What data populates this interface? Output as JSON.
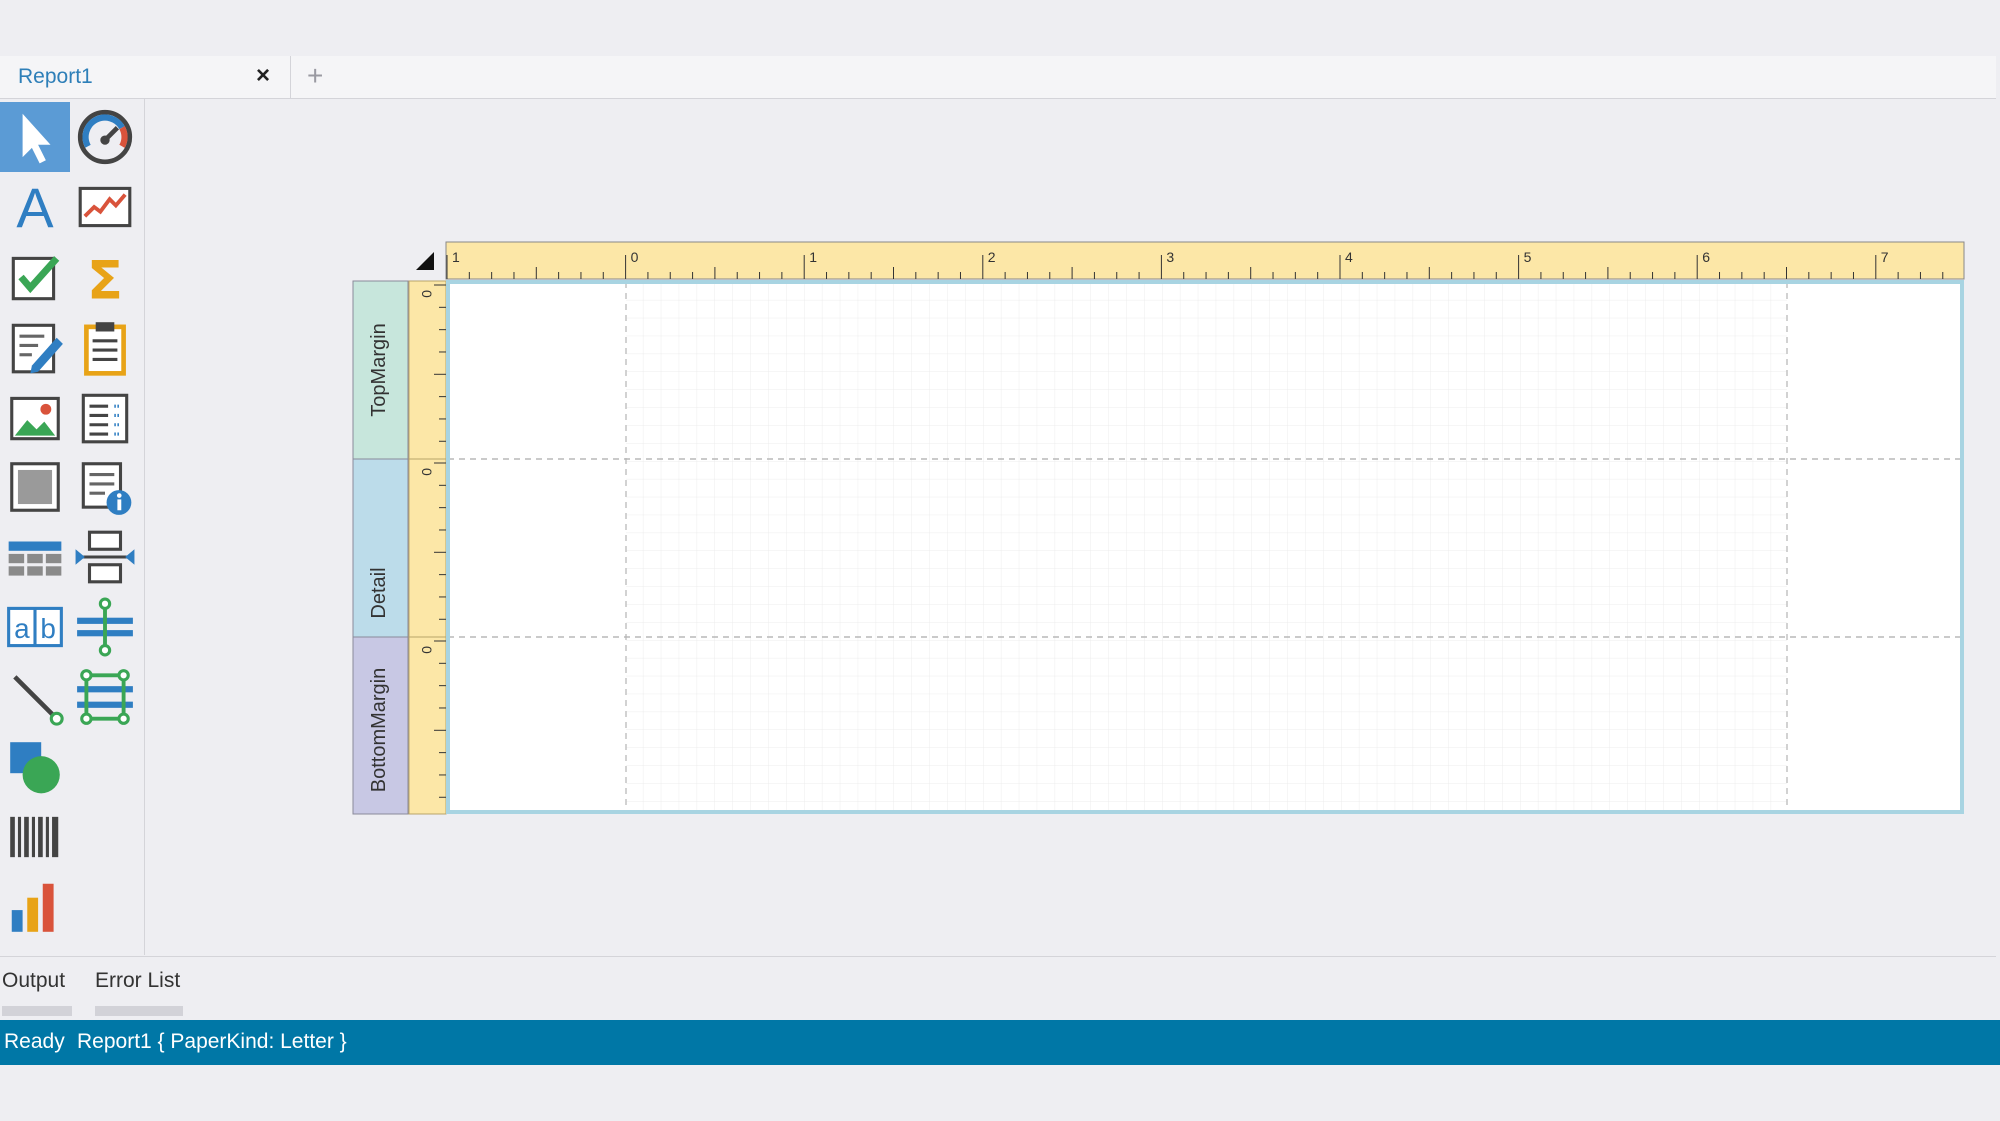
{
  "tabs": {
    "active_label": "Report1",
    "close_glyph": "×",
    "add_glyph": "+"
  },
  "toolbox": {
    "tools": [
      {
        "name": "pointer",
        "icon": "pointer-icon",
        "selected": true
      },
      {
        "name": "gauge",
        "icon": "gauge-icon"
      },
      {
        "name": "label",
        "icon": "label-icon",
        "glyph": "A"
      },
      {
        "name": "sparkline",
        "icon": "sparkline-icon"
      },
      {
        "name": "checkbox",
        "icon": "checkbox-icon"
      },
      {
        "name": "summary",
        "icon": "sigma-icon",
        "glyph": "Σ"
      },
      {
        "name": "richtext",
        "icon": "richtext-icon"
      },
      {
        "name": "subreport",
        "icon": "clipboard-icon"
      },
      {
        "name": "picture",
        "icon": "picture-icon"
      },
      {
        "name": "table-of-contents",
        "icon": "toc-icon"
      },
      {
        "name": "panel",
        "icon": "panel-icon"
      },
      {
        "name": "page-info",
        "icon": "page-info-icon"
      },
      {
        "name": "table",
        "icon": "table-icon"
      },
      {
        "name": "page-break",
        "icon": "page-break-icon"
      },
      {
        "name": "character-comb",
        "icon": "character-comb-icon",
        "glyph_a": "a",
        "glyph_b": "b"
      },
      {
        "name": "cross-band-line",
        "icon": "cross-band-line-icon"
      },
      {
        "name": "line",
        "icon": "line-icon"
      },
      {
        "name": "cross-band-box",
        "icon": "cross-band-box-icon"
      },
      {
        "name": "shape",
        "icon": "shape-icon"
      },
      {
        "name": "barcode",
        "icon": "barcode-icon"
      },
      {
        "name": "chart",
        "icon": "chart-icon"
      }
    ]
  },
  "designer": {
    "ruler_numbers": [
      "1",
      "0",
      "1",
      "2",
      "3",
      "4",
      "5",
      "6",
      "7"
    ],
    "bands": [
      {
        "label": "TopMargin",
        "ruler_zero": "0",
        "color": "#c7e6dc"
      },
      {
        "label": "Detail",
        "ruler_zero": "0",
        "color": "#bcdcea"
      },
      {
        "label": "BottomMargin",
        "ruler_zero": "0",
        "color": "#c8c8e4"
      }
    ],
    "ruler_color": "#fce7a7",
    "page_border_color": "#a8d4e2"
  },
  "bottom_panel": {
    "tabs": [
      "Output",
      "Error List"
    ]
  },
  "status": {
    "ready": "Ready",
    "info": "Report1 { PaperKind: Letter }",
    "background": "#0077a6"
  }
}
